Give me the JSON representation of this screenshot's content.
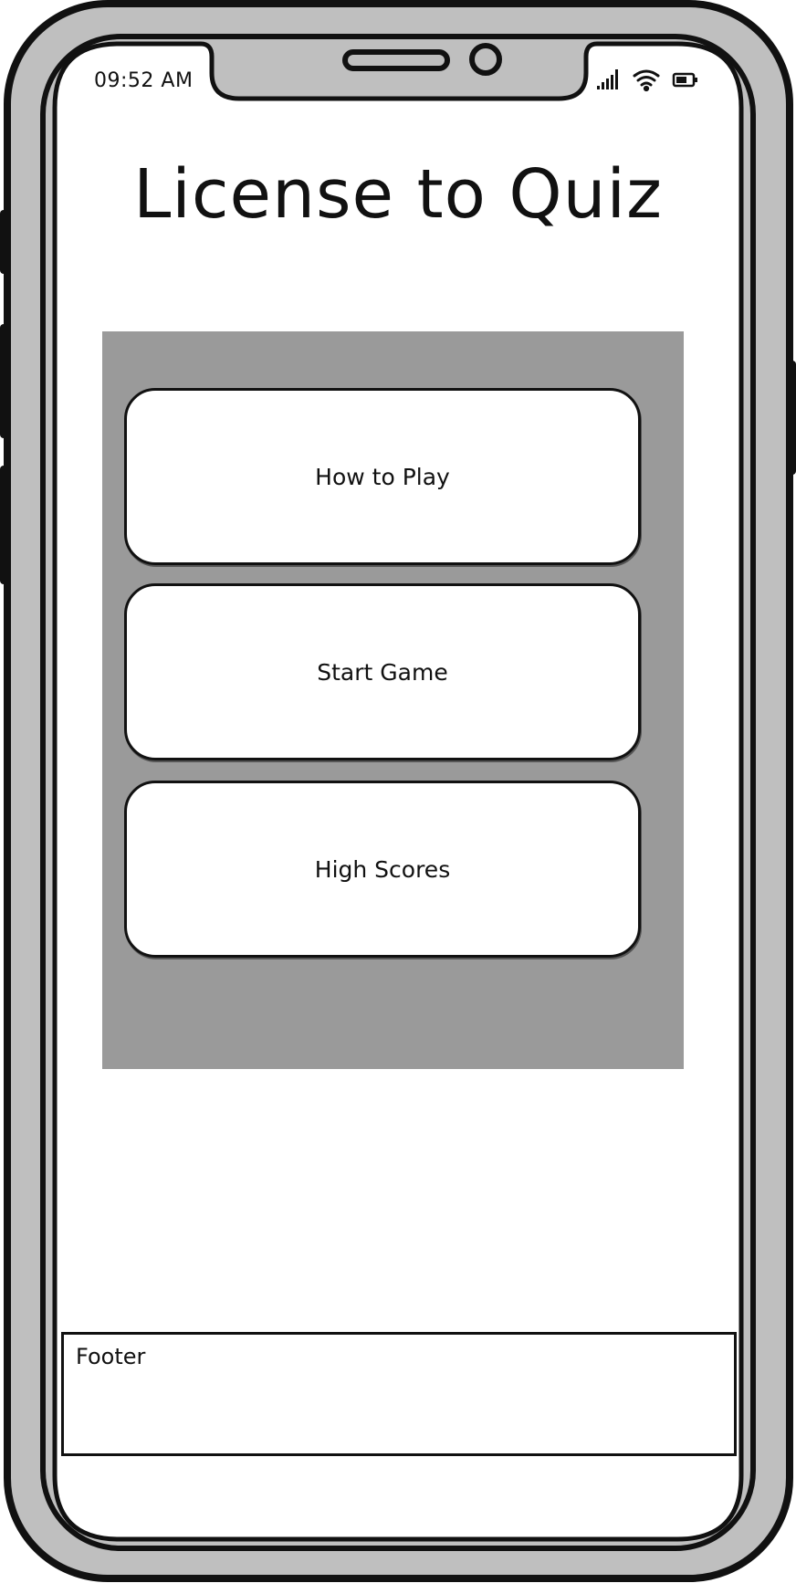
{
  "status_bar": {
    "time": "09:52 AM",
    "icons": [
      "signal-icon",
      "wifi-icon",
      "battery-icon"
    ]
  },
  "app": {
    "title": "License to Quiz"
  },
  "menu": {
    "how_to_play_label": "How to Play",
    "start_game_label": "Start Game",
    "high_scores_label": "High Scores"
  },
  "footer": {
    "label": "Footer"
  },
  "colors": {
    "frame": "#bfbfbf",
    "outline": "#111111",
    "panel": "#9a9a9a",
    "screen": "#ffffff"
  }
}
